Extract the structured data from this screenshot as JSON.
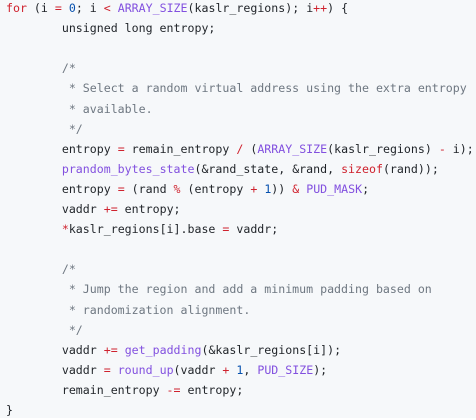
{
  "code": {
    "language": "c",
    "lines": [
      [
        {
          "t": "for",
          "c": "kw"
        },
        {
          "t": " (i ",
          "c": "pl"
        },
        {
          "t": "=",
          "c": "op"
        },
        {
          "t": " ",
          "c": "pl"
        },
        {
          "t": "0",
          "c": "num"
        },
        {
          "t": "; i ",
          "c": "pl"
        },
        {
          "t": "<",
          "c": "op"
        },
        {
          "t": " ",
          "c": "pl"
        },
        {
          "t": "ARRAY_SIZE",
          "c": "mac"
        },
        {
          "t": "(kaslr_regions); i",
          "c": "pl"
        },
        {
          "t": "++",
          "c": "op"
        },
        {
          "t": ") {",
          "c": "pl"
        }
      ],
      [
        {
          "t": "        unsigned long entropy;",
          "c": "pl"
        }
      ],
      [],
      [
        {
          "t": "        /*",
          "c": "cm"
        }
      ],
      [
        {
          "t": "         * Select a random virtual address using the extra entropy",
          "c": "cm"
        }
      ],
      [
        {
          "t": "         * available.",
          "c": "cm"
        }
      ],
      [
        {
          "t": "         */",
          "c": "cm"
        }
      ],
      [
        {
          "t": "        entropy ",
          "c": "pl"
        },
        {
          "t": "=",
          "c": "op"
        },
        {
          "t": " remain_entropy ",
          "c": "pl"
        },
        {
          "t": "/",
          "c": "op"
        },
        {
          "t": " (",
          "c": "pl"
        },
        {
          "t": "ARRAY_SIZE",
          "c": "mac"
        },
        {
          "t": "(kaslr_regions) ",
          "c": "pl"
        },
        {
          "t": "-",
          "c": "op"
        },
        {
          "t": " i);",
          "c": "pl"
        }
      ],
      [
        {
          "t": "        ",
          "c": "pl"
        },
        {
          "t": "prandom_bytes_state",
          "c": "fn"
        },
        {
          "t": "(&rand_state, &rand, ",
          "c": "pl"
        },
        {
          "t": "sizeof",
          "c": "kw"
        },
        {
          "t": "(rand));",
          "c": "pl"
        }
      ],
      [
        {
          "t": "        entropy ",
          "c": "pl"
        },
        {
          "t": "=",
          "c": "op"
        },
        {
          "t": " (rand ",
          "c": "pl"
        },
        {
          "t": "%",
          "c": "op"
        },
        {
          "t": " (entropy ",
          "c": "pl"
        },
        {
          "t": "+",
          "c": "op"
        },
        {
          "t": " ",
          "c": "pl"
        },
        {
          "t": "1",
          "c": "num"
        },
        {
          "t": ")) ",
          "c": "pl"
        },
        {
          "t": "&",
          "c": "op"
        },
        {
          "t": " ",
          "c": "pl"
        },
        {
          "t": "PUD_MASK",
          "c": "mac"
        },
        {
          "t": ";",
          "c": "pl"
        }
      ],
      [
        {
          "t": "        vaddr ",
          "c": "pl"
        },
        {
          "t": "+=",
          "c": "op"
        },
        {
          "t": " entropy;",
          "c": "pl"
        }
      ],
      [
        {
          "t": "        ",
          "c": "pl"
        },
        {
          "t": "*",
          "c": "op"
        },
        {
          "t": "kaslr_regions[i].base ",
          "c": "pl"
        },
        {
          "t": "=",
          "c": "op"
        },
        {
          "t": " vaddr;",
          "c": "pl"
        }
      ],
      [],
      [
        {
          "t": "        /*",
          "c": "cm"
        }
      ],
      [
        {
          "t": "         * Jump the region and add a minimum padding based on",
          "c": "cm"
        }
      ],
      [
        {
          "t": "         * randomization alignment.",
          "c": "cm"
        }
      ],
      [
        {
          "t": "         */",
          "c": "cm"
        }
      ],
      [
        {
          "t": "        vaddr ",
          "c": "pl"
        },
        {
          "t": "+=",
          "c": "op"
        },
        {
          "t": " ",
          "c": "pl"
        },
        {
          "t": "get_padding",
          "c": "fn"
        },
        {
          "t": "(&kaslr_regions[i]);",
          "c": "pl"
        }
      ],
      [
        {
          "t": "        vaddr ",
          "c": "pl"
        },
        {
          "t": "=",
          "c": "op"
        },
        {
          "t": " ",
          "c": "pl"
        },
        {
          "t": "round_up",
          "c": "fn"
        },
        {
          "t": "(vaddr ",
          "c": "pl"
        },
        {
          "t": "+",
          "c": "op"
        },
        {
          "t": " ",
          "c": "pl"
        },
        {
          "t": "1",
          "c": "num"
        },
        {
          "t": ", ",
          "c": "pl"
        },
        {
          "t": "PUD_SIZE",
          "c": "mac"
        },
        {
          "t": ");",
          "c": "pl"
        }
      ],
      [
        {
          "t": "        remain_entropy ",
          "c": "pl"
        },
        {
          "t": "-=",
          "c": "op"
        },
        {
          "t": " entropy;",
          "c": "pl"
        }
      ],
      [
        {
          "t": "}",
          "c": "pl"
        }
      ]
    ]
  },
  "colors": {
    "background": "#f6f8fa",
    "keyword": "#cf222e",
    "function": "#8250df",
    "number": "#0550ae",
    "comment": "#6e7781",
    "plain": "#1f2328"
  }
}
